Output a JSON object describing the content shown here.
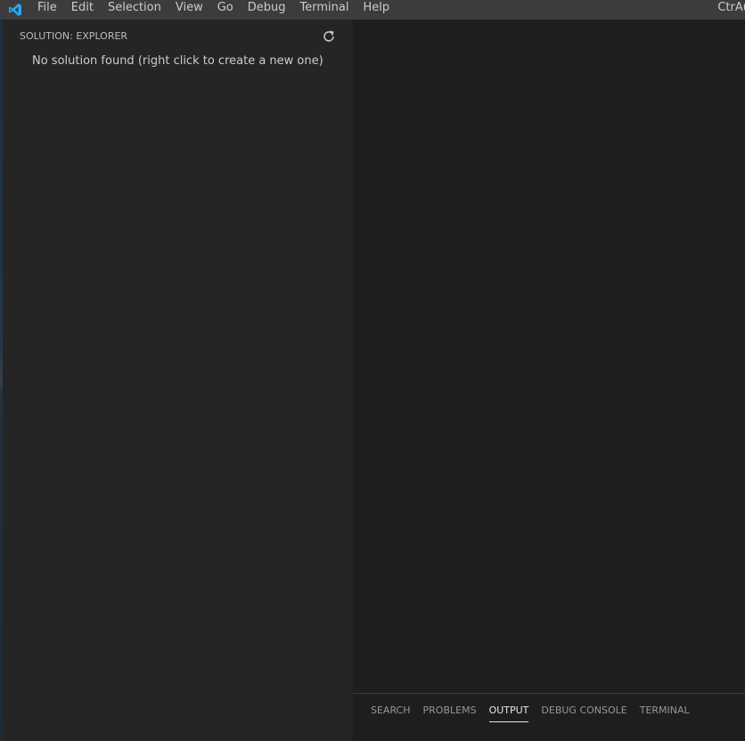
{
  "menu": {
    "items": [
      {
        "label": "File"
      },
      {
        "label": "Edit"
      },
      {
        "label": "Selection"
      },
      {
        "label": "View"
      },
      {
        "label": "Go"
      },
      {
        "label": "Debug"
      },
      {
        "label": "Terminal"
      },
      {
        "label": "Help"
      }
    ]
  },
  "window": {
    "title": "CtrAu"
  },
  "sidebar": {
    "header": "SOLUTION: EXPLORER",
    "empty_message": "No solution found (right click to create a new one)",
    "refresh_icon": "refresh-icon"
  },
  "panel": {
    "tabs": [
      {
        "label": "SEARCH",
        "active": false
      },
      {
        "label": "PROBLEMS",
        "active": false
      },
      {
        "label": "OUTPUT",
        "active": true
      },
      {
        "label": "DEBUG CONSOLE",
        "active": false
      },
      {
        "label": "TERMINAL",
        "active": false
      }
    ]
  },
  "colors": {
    "titlebar": "#3c3c3c",
    "sidebar": "#252526",
    "editor": "#1e1e1e",
    "accent": "#0078d4"
  }
}
